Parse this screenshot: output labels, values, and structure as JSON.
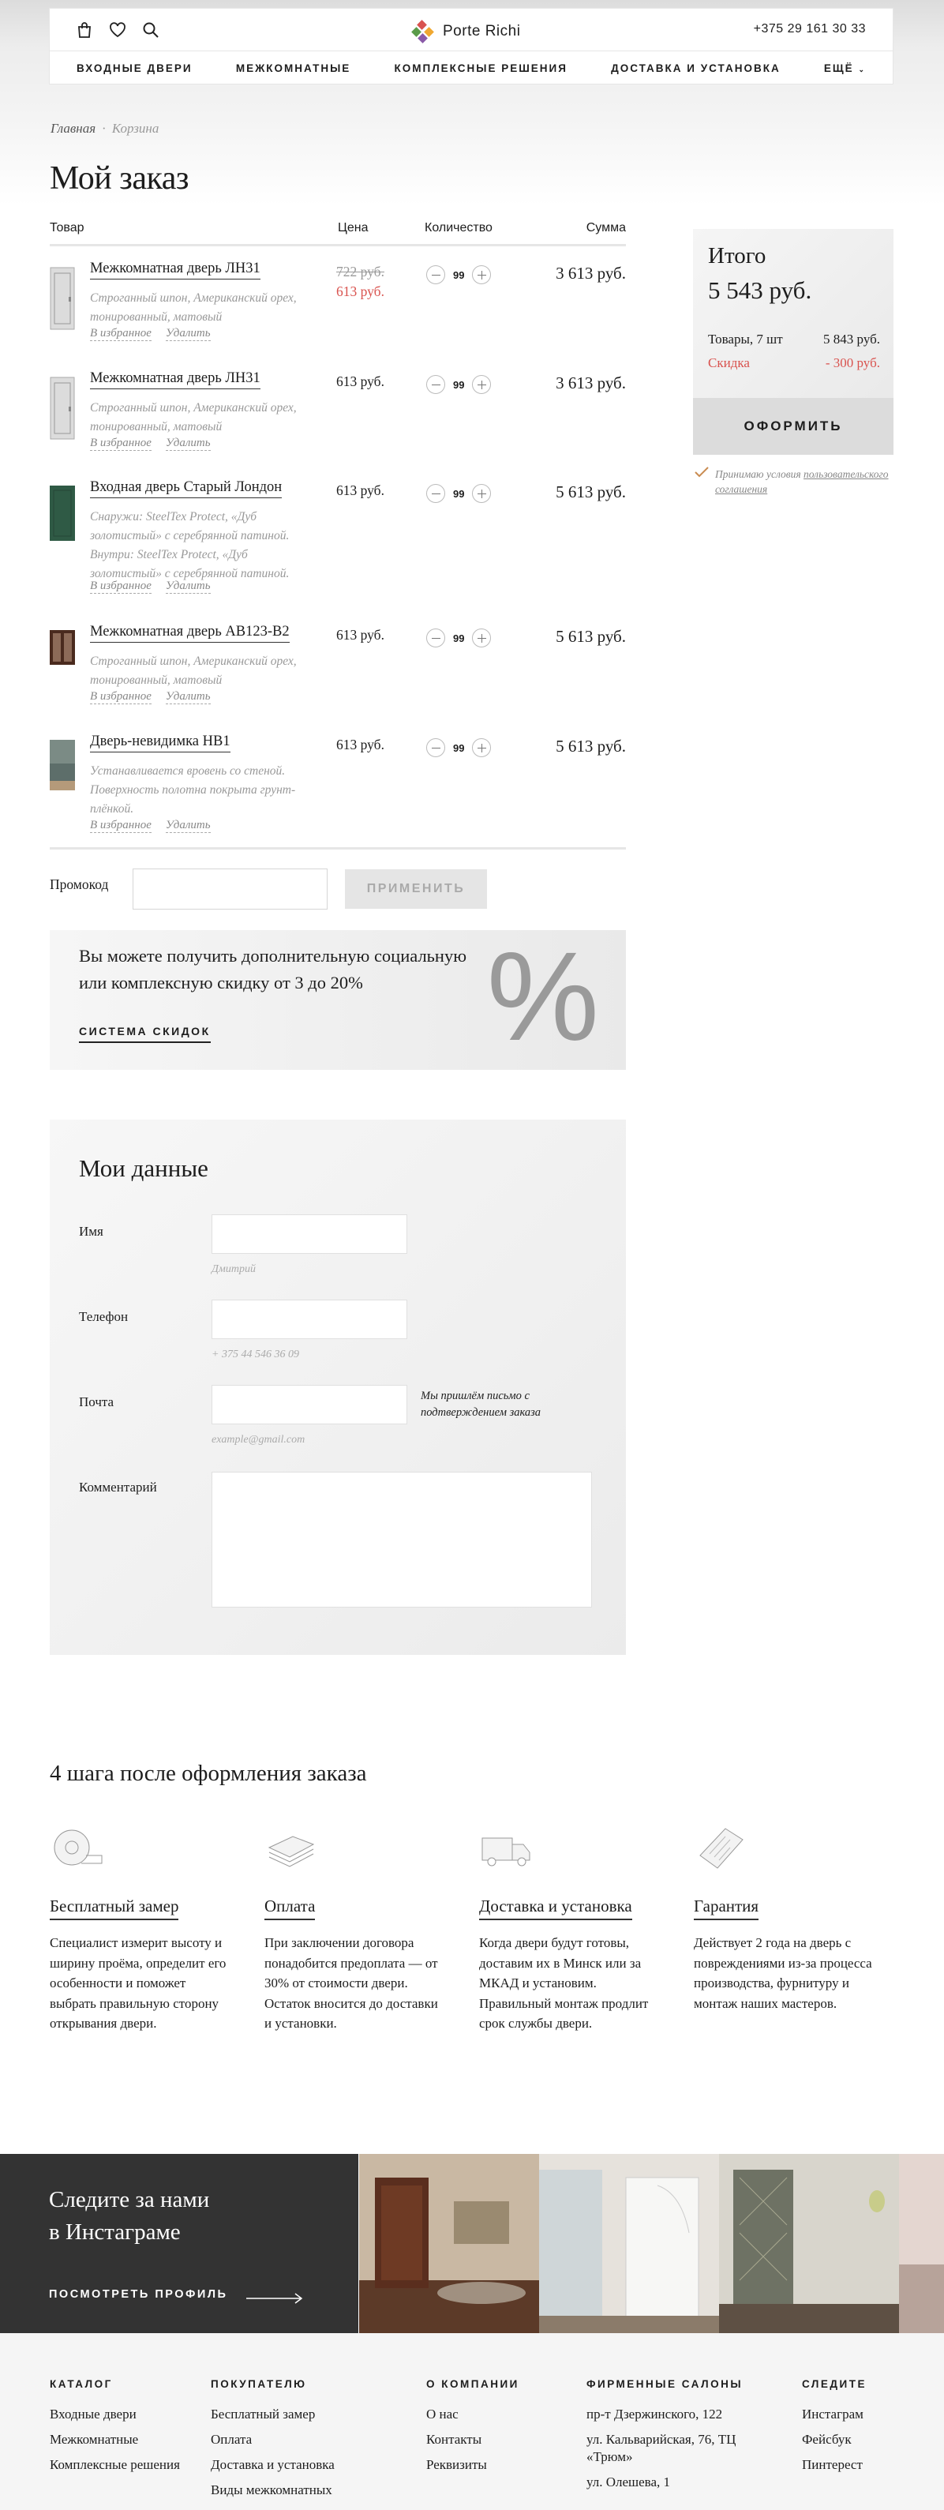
{
  "header": {
    "logo_text": "Porte Richi",
    "phone": "+375 29 161 30 33",
    "nav": [
      "ВХОДНЫЕ ДВЕРИ",
      "МЕЖКОМНАТНЫЕ",
      "КОМПЛЕКСНЫЕ РЕШЕНИЯ",
      "ДОСТАВКА И УСТАНОВКА",
      "ЕЩЁ"
    ],
    "icons": [
      "bag-icon",
      "heart-icon",
      "search-icon"
    ]
  },
  "breadcrumb": {
    "home": "Главная",
    "sep": "·",
    "current": "Корзина"
  },
  "page_title": "Мой заказ",
  "table": {
    "headers": {
      "product": "Товар",
      "price": "Цена",
      "qty": "Количество",
      "sum": "Сумма"
    },
    "add_fav": "В избранное",
    "remove": "Удалить",
    "items": [
      {
        "name": "Межкомнатная дверь ЛН31",
        "desc": "Строганный шпон, Американский орех, тонированный, матовый",
        "old_price": "722 руб.",
        "price": "613 руб.",
        "qty": "99",
        "sum": "3 613 руб."
      },
      {
        "name": "Межкомнатная дверь ЛН31",
        "desc": "Строганный шпон, Американский орех, тонированный, матовый",
        "price": "613 руб.",
        "qty": "99",
        "sum": "3 613 руб."
      },
      {
        "name": "Входная дверь Старый Лондон",
        "desc": "Снаружи: SteelTex Protect, «Дуб золотистый» с серебрянной патиной. Внутри: SteelTex Protect, «Дуб золотистый» с серебрянной патиной.",
        "price": "613 руб.",
        "qty": "99",
        "sum": "5 613 руб."
      },
      {
        "name": "Межкомнатная дверь АВ123-В2",
        "desc": "Строганный шпон, Американский орех, тонированный, матовый",
        "price": "613 руб.",
        "qty": "99",
        "sum": "5 613 руб."
      },
      {
        "name": "Дверь-невидимка НВ1",
        "desc": "Устанавливается вровень со стеной. Поверхность полотна покрыта грунт-плёнкой.",
        "price": "613 руб.",
        "qty": "99",
        "sum": "5 613 руб."
      }
    ]
  },
  "summary": {
    "title": "Итого",
    "total": "5 543 руб.",
    "goods_label": "Товары, 7 шт",
    "goods_value": "5 843 руб.",
    "discount_label": "Скидка",
    "discount_value": "- 300 руб.",
    "order_button": "ОФОРМИТЬ",
    "agree_text": "Принимаю условия",
    "agree_link": "пользовательского соглашения"
  },
  "promo": {
    "label": "Промокод",
    "button": "ПРИМЕНИТЬ"
  },
  "discount_banner": {
    "text": "Вы можете получить дополнительную социальную или комплексную скидку от 3 до 20%",
    "link": "СИСТЕМА СКИДОК",
    "symbol": "%"
  },
  "my_data": {
    "title": "Мои данные",
    "name_label": "Имя",
    "name_hint": "Дмитрий",
    "phone_label": "Телефон",
    "phone_hint": "+ 375 44 546 36 09",
    "email_label": "Почта",
    "email_hint": "example@gmail.com",
    "email_note": "Мы пришлём письмо с подтверждением заказа",
    "comment_label": "Комментарий"
  },
  "steps": {
    "title": "4 шага после оформления заказа",
    "items": [
      {
        "title": "Бесплатный замер",
        "text": "Специалист измерит высоту и ширину проёма, определит его особенности и поможет выбрать правильную сторону открывания двери.",
        "icon": "tape-measure-icon"
      },
      {
        "title": "Оплата",
        "text": "При заключении договора понадобится предоплата — от 30% от стоимости двери. Остаток вносится до доставки и установки.",
        "icon": "cash-icon"
      },
      {
        "title": "Доставка и установка",
        "text": "Когда двери будут готовы, доставим их в Минск или за МКАД и установим. Правильный монтаж продлит срок службы двери.",
        "icon": "truck-icon"
      },
      {
        "title": "Гарантия",
        "text": "Действует 2 года на дверь с повреждениями из-за процесса производства, фурнитуру и монтаж наших мастеров.",
        "icon": "warranty-document-icon"
      }
    ]
  },
  "instagram": {
    "title_line1": "Следите за нами",
    "title_line2": "в Инстаграме",
    "link": "ПОСМОТРЕТЬ ПРОФИЛЬ"
  },
  "footer": {
    "columns": [
      {
        "heading": "КАТАЛОГ",
        "items": [
          "Входные двери",
          "Межкомнатные",
          "Комплексные решения"
        ]
      },
      {
        "heading": "ПОКУПАТЕЛЮ",
        "items": [
          "Бесплатный замер",
          "Оплата",
          "Доставка и установка",
          "Виды межкомнатных"
        ]
      },
      {
        "heading": "О КОМПАНИИ",
        "items": [
          "О нас",
          "Контакты",
          "Реквизиты"
        ]
      },
      {
        "heading": "ФИРМЕННЫЕ САЛОНЫ",
        "items": [
          "пр-т Дзержинского, 122",
          "ул. Кальварийская, 76, ТЦ «Трюм»",
          "ул. Олешева, 1"
        ]
      },
      {
        "heading": "СЛЕДИТЕ",
        "items": [
          "Инстаграм",
          "Фейсбук",
          "Пинтерест"
        ]
      }
    ]
  },
  "colors": {
    "accent_red": "#d9534f",
    "dark": "#333333",
    "panel": "#eeeeee"
  }
}
